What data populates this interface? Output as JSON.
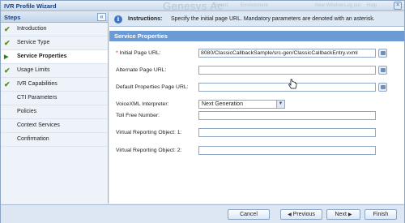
{
  "window": {
    "title": "IVR Profile Wizard",
    "background_brand": "Genesys Ac",
    "background_small": [
      "Tenant:",
      "Environment",
      "New Window",
      "Log out",
      "Help"
    ]
  },
  "sidebar": {
    "header": "Steps",
    "collapse_glyph": "«",
    "items": [
      {
        "label": "Introduction",
        "state": "done"
      },
      {
        "label": "Service Type",
        "state": "done"
      },
      {
        "label": "Service Properties",
        "state": "active"
      },
      {
        "label": "Usage Limits",
        "state": "done"
      },
      {
        "label": "IVR Capabilities",
        "state": "done"
      },
      {
        "label": "CTI Parameters",
        "state": "pending"
      },
      {
        "label": "Policies",
        "state": "pending"
      },
      {
        "label": "Context Services",
        "state": "pending"
      },
      {
        "label": "Confirmation",
        "state": "pending"
      }
    ]
  },
  "instructions": {
    "label": "Instructions:",
    "text": "Specify the initial page URL. Mandatory parameters are denoted with an asterisk."
  },
  "section": {
    "title": "Service Properties"
  },
  "fields": {
    "initial_url": {
      "required_mark": "*",
      "label": "Initial Page URL:",
      "value": "8080/ClassicCallbackSample/src-gen/ClassicCallbackEntry.vxml"
    },
    "alternate_url": {
      "label": "Alternate Page URL:",
      "value": ""
    },
    "default_props_url": {
      "label": "Default Properties Page URL:",
      "value": ""
    },
    "voicexml": {
      "label": "VoiceXML Interpreter:",
      "value": "Next Generation"
    },
    "toll_free": {
      "label": "Toll Free Number:",
      "value": ""
    },
    "vro1": {
      "label": "Virtual Reporting Object: 1:",
      "value": ""
    },
    "vro2": {
      "label": "Virtual Reporting Object: 2:",
      "value": ""
    }
  },
  "footer": {
    "cancel": "Cancel",
    "previous": "Previous",
    "next": "Next",
    "finish": "Finish"
  },
  "colors": {
    "section_header": "#6b9bd5",
    "check": "#5a8a1c",
    "required": "#d01010",
    "info_icon": "#3d74c6"
  }
}
